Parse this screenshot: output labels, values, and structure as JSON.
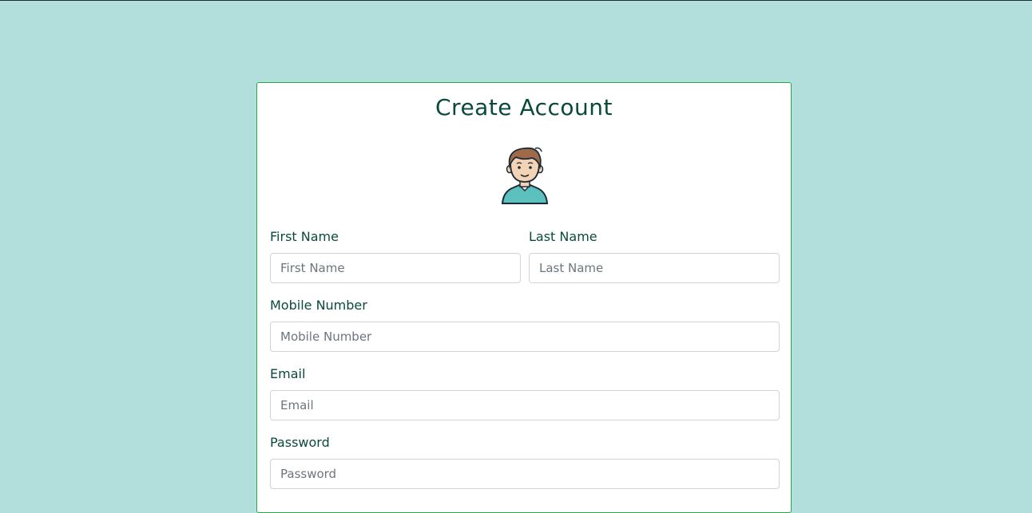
{
  "page": {
    "background_color": "#b2dfdb",
    "card_border_color": "#28a745",
    "text_color": "#0a4a3c"
  },
  "form": {
    "title": "Create Account",
    "avatar_icon": "user-avatar-icon",
    "fields": {
      "first_name": {
        "label": "First Name",
        "placeholder": "First Name",
        "value": ""
      },
      "last_name": {
        "label": "Last Name",
        "placeholder": "Last Name",
        "value": ""
      },
      "mobile": {
        "label": "Mobile Number",
        "placeholder": "Mobile Number",
        "value": ""
      },
      "email": {
        "label": "Email",
        "placeholder": "Email",
        "value": ""
      },
      "password": {
        "label": "Password",
        "placeholder": "Password",
        "value": ""
      }
    }
  }
}
